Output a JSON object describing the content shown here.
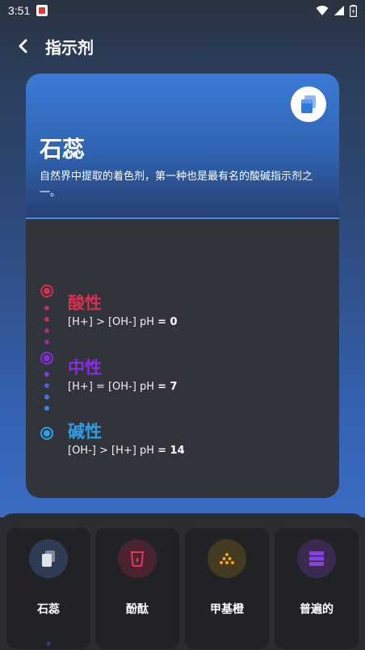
{
  "status_bar": {
    "time": "3:51"
  },
  "app_bar": {
    "title": "指示剂"
  },
  "card": {
    "title": "石蕊",
    "description": "自然界中提取的着色剂，第一种也是最有名的酸碱指示剂之一。",
    "timeline": [
      {
        "label": "酸性",
        "formula": "[H+] > [OH-] pH ",
        "ph": "= 0",
        "color": "#d4304f"
      },
      {
        "label": "中性",
        "formula": "[H+] = [OH-] pH ",
        "ph": "= 7",
        "color": "#8a2be2"
      },
      {
        "label": "碱性",
        "formula": "[OH-] > [H+] pH ",
        "ph": "= 14",
        "color": "#2e9fe6"
      }
    ]
  },
  "tabs": [
    {
      "label": "石蕊",
      "icon": "litmus-icon",
      "icon_bg": "#2e3d55"
    },
    {
      "label": "酚酞",
      "icon": "phenolphthalein-icon",
      "icon_bg": "#4a2330"
    },
    {
      "label": "甲基橙",
      "icon": "methyl-orange-icon",
      "icon_bg": "#443a1f"
    },
    {
      "label": "普遍的",
      "icon": "universal-icon",
      "icon_bg": "#3a2a4f"
    }
  ]
}
